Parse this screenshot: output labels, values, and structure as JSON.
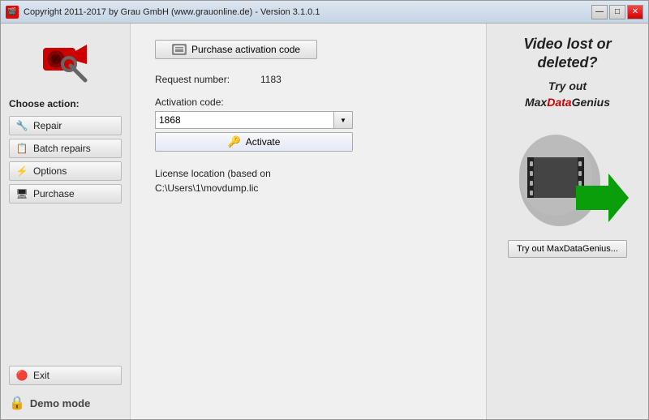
{
  "window": {
    "title": "Copyright 2011-2017 by Grau GmbH (www.grauonline.de) - Version 3.1.0.1",
    "title_icon": "🎬"
  },
  "title_buttons": {
    "minimize": "—",
    "maximize": "□",
    "close": "✕"
  },
  "sidebar": {
    "choose_label": "Choose action:",
    "buttons": [
      {
        "id": "repair",
        "label": "Repair",
        "icon": "🔧"
      },
      {
        "id": "batch",
        "label": "Batch repairs",
        "icon": "📋"
      },
      {
        "id": "options",
        "label": "Options",
        "icon": "⚡"
      },
      {
        "id": "purchase",
        "label": "Purchase",
        "icon": "🖥"
      }
    ],
    "exit_label": "Exit",
    "exit_icon": "🔴",
    "demo_label": "Demo mode",
    "lock_icon": "🔒"
  },
  "main": {
    "purchase_btn_label": "Purchase activation code",
    "request_label": "Request number:",
    "request_value": "1183",
    "activation_label": "Activation code:",
    "activation_value": "1868",
    "activate_label": "Activate",
    "license_label": "License location (based on",
    "license_path": "C:\\Users\\1\\movdump.lic"
  },
  "promo": {
    "line1": "Video lost or",
    "line2": "deleted?",
    "try_out": "Try out",
    "brand_max": "Max",
    "brand_data": "Data",
    "brand_genius": "Genius",
    "try_btn": "Try out MaxDataGenius..."
  }
}
